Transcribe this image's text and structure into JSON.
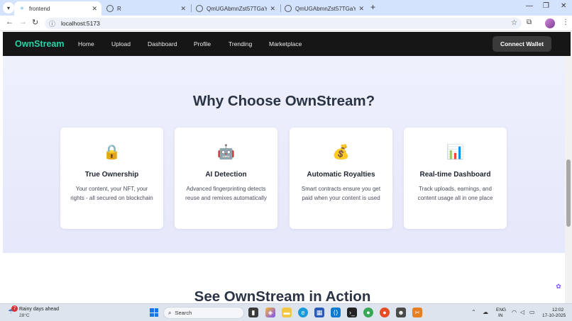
{
  "browser": {
    "tabs": [
      {
        "title": "frontend",
        "icon": "react-favicon",
        "active": true
      },
      {
        "title": "R",
        "icon": "globe-favicon",
        "active": false
      },
      {
        "title": "QmUGAbmnZst57TGaYtXzXdG...",
        "icon": "globe-favicon",
        "active": false
      },
      {
        "title": "QmUGAbmnZst57TGaYtXzXdG...",
        "icon": "globe-favicon",
        "active": false
      }
    ],
    "new_tab": "+",
    "url": "localhost:5173",
    "window_controls": {
      "minimize": "—",
      "maximize": "❐",
      "close": "✕"
    }
  },
  "site": {
    "logo": "OwnStream",
    "nav": [
      "Home",
      "Upload",
      "Dashboard",
      "Profile",
      "Trending",
      "Marketplace"
    ],
    "connect_wallet": "Connect Wallet",
    "features_heading": "Why Choose OwnStream?",
    "features": [
      {
        "icon": "🔒",
        "icon_name": "lock-icon",
        "title": "True Ownership",
        "desc": "Your content, your NFT, your rights - all secured on blockchain"
      },
      {
        "icon": "🤖",
        "icon_name": "robot-icon",
        "title": "AI Detection",
        "desc": "Advanced fingerprinting detects reuse and remixes automatically"
      },
      {
        "icon": "💰",
        "icon_name": "money-bag-icon",
        "title": "Automatic Royalties",
        "desc": "Smart contracts ensure you get paid when your content is used"
      },
      {
        "icon": "📊",
        "icon_name": "bar-chart-icon",
        "title": "Real-time Dashboard",
        "desc": "Track uploads, earnings, and content usage all in one place"
      }
    ],
    "next_heading": "See OwnStream in Action"
  },
  "taskbar": {
    "weather_badge": "7",
    "weather_title": "Rainy days ahead",
    "weather_temp": "28°C",
    "search_placeholder": "Search",
    "lang_line1": "ENG",
    "lang_line2": "IN",
    "time": "12:02",
    "date": "17-10-2025"
  },
  "colors": {
    "logo": "#2bd1a6",
    "navbar_bg": "#161616",
    "section_bg": "#eef0fc",
    "heading": "#2b3445"
  }
}
